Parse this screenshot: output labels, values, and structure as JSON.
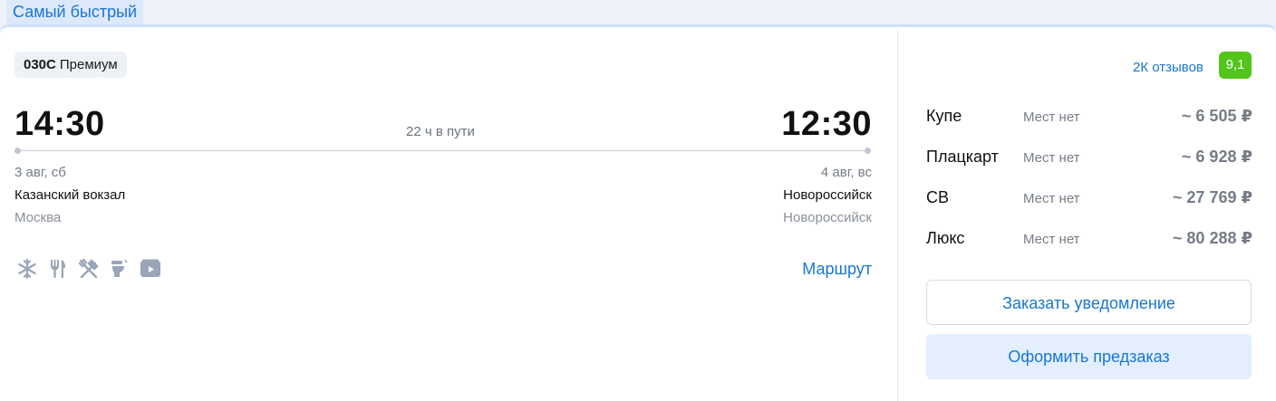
{
  "tag": "Самый быстрый",
  "train": {
    "number": "030С",
    "name": "Премиум"
  },
  "departure": {
    "time": "14:30",
    "date": "3 авг, сб",
    "station": "Казанский вокзал",
    "city": "Москва"
  },
  "arrival": {
    "time": "12:30",
    "date": "4 авг, вс",
    "station": "Новороссийск",
    "city": "Новороссийск"
  },
  "duration": "22 ч в пути",
  "amenities": [
    "snowflake-icon",
    "fork-knife-icon",
    "restaurant-icon",
    "toilet-icon",
    "video-icon"
  ],
  "route_link": "Маршрут",
  "reviews": {
    "label": "2К отзывов",
    "rating": "9,1"
  },
  "fares": [
    {
      "class": "Купе",
      "seats": "Мест нет",
      "price": "~ 6 505 ₽"
    },
    {
      "class": "Плацкарт",
      "seats": "Мест нет",
      "price": "~ 6 928 ₽"
    },
    {
      "class": "СВ",
      "seats": "Мест нет",
      "price": "~ 27 769 ₽"
    },
    {
      "class": "Люкс",
      "seats": "Мест нет",
      "price": "~ 80 288 ₽"
    }
  ],
  "buttons": {
    "notify": "Заказать уведомление",
    "preorder": "Оформить предзаказ"
  },
  "colors": {
    "accent": "#1976d2",
    "rating_bg": "#52c41a",
    "tag_bg": "#dde9fb",
    "icon": "#9aa5b8"
  }
}
